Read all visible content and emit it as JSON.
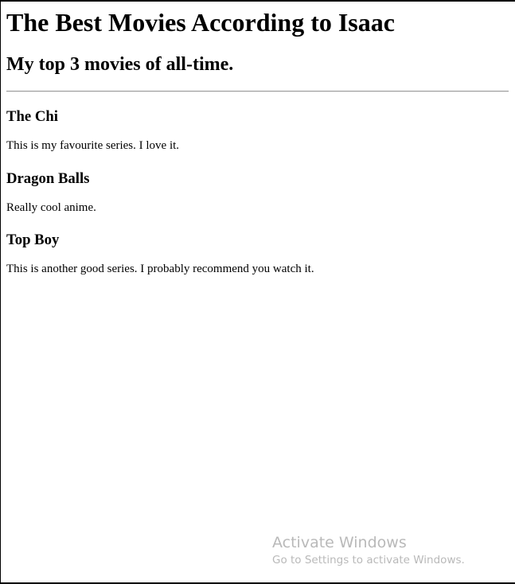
{
  "page": {
    "title": "The Best Movies According to Isaac",
    "subtitle": "My top 3 movies of all-time."
  },
  "movies": [
    {
      "title": "The Chi",
      "description": "This is my favourite series. I love it."
    },
    {
      "title": "Dragon Balls",
      "description": "Really cool anime."
    },
    {
      "title": "Top Boy",
      "description": "This is another good series. I probably recommend you watch it."
    }
  ],
  "watermark": {
    "title": "Activate Windows",
    "subtitle": "Go to Settings to activate Windows."
  }
}
